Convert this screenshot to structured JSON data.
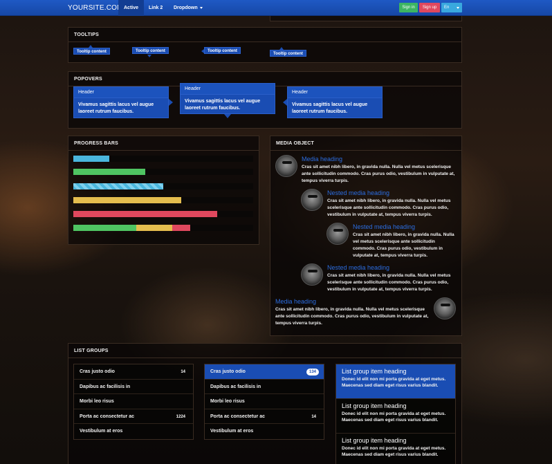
{
  "navbar": {
    "brand": "YOURSITE.COM",
    "items": [
      {
        "label": "Active"
      },
      {
        "label": "Link 2"
      },
      {
        "label": "Dropdown"
      }
    ],
    "buttons": {
      "signin": "Sign in",
      "signup": "Sign up",
      "lang": "En"
    }
  },
  "tooltips": {
    "title": "TOOLTIPS",
    "items": [
      "Tooltip content",
      "Tooltip content",
      "Tooltip content",
      "Tooltip content"
    ]
  },
  "popovers": {
    "title": "POPOVERS",
    "items": [
      {
        "header": "Header",
        "body": "Vivamus sagittis lacus vel augue laoreet rutrum faucibus."
      },
      {
        "header": "Header",
        "body": "Vivamus sagittis lacus vel augue laoreet rutrum faucibus."
      },
      {
        "header": "Header",
        "body": "Vivamus sagittis lacus vel augue laoreet rutrum faucibus."
      }
    ]
  },
  "progress": {
    "title": "PROGRESS BARS",
    "bars": [
      {
        "value": 20,
        "color": "#4ab6dd"
      },
      {
        "value": 40,
        "color": "#4fc462"
      },
      {
        "value": 50,
        "color": "#4ab6dd",
        "striped": true
      },
      {
        "value": 60,
        "color": "#e5bd4e"
      },
      {
        "value": 80,
        "color": "#e0485e"
      }
    ],
    "stacked": [
      {
        "value": 35,
        "color": "#4fc462"
      },
      {
        "value": 20,
        "color": "#e5bd4e"
      },
      {
        "value": 10,
        "color": "#e0485e"
      }
    ]
  },
  "media": {
    "title": "MEDIA OBJECT",
    "items": [
      {
        "heading": "Media heading",
        "text": "Cras sit amet nibh libero, in gravida nulla. Nulla vel metus scelerisque ante sollicitudin commodo. Cras purus odio, vestibulum in vulputate at, tempus viverra turpis."
      },
      {
        "heading": "Nested media heading",
        "text": "Cras sit amet nibh libero, in gravida nulla. Nulla vel metus scelerisque ante sollicitudin commodo. Cras purus odio, vestibulum in vulputate at, tempus viverra turpis."
      },
      {
        "heading": "Nested media heading",
        "text": "Cras sit amet nibh libero, in gravida nulla. Nulla vel metus scelerisque ante sollicitudin commodo. Cras purus odio, vestibulum in vulputate at, tempus viverra turpis."
      },
      {
        "heading": "Nested media heading",
        "text": "Cras sit amet nibh libero, in gravida nulla. Nulla vel metus scelerisque ante sollicitudin commodo. Cras purus odio, vestibulum in vulputate at, tempus viverra turpis."
      },
      {
        "heading": "Media heading",
        "text": "Cras sit amet nibh libero, in gravida nulla. Nulla vel metus scelerisque ante sollicitudin commodo. Cras purus odio, vestibulum in vulputate at, tempus viverra turpis."
      }
    ]
  },
  "list_groups": {
    "title": "LIST GROUPS",
    "group1": [
      {
        "label": "Cras justo odio",
        "badge": "14"
      },
      {
        "label": "Dapibus ac facilisis in",
        "badge": ""
      },
      {
        "label": "Morbi leo risus",
        "badge": ""
      },
      {
        "label": "Porta ac consectetur ac",
        "badge": "1224"
      },
      {
        "label": "Vestibulum at eros",
        "badge": ""
      }
    ],
    "group2": [
      {
        "label": "Cras justo odio",
        "badge": "134"
      },
      {
        "label": "Dapibus ac facilisis in",
        "badge": ""
      },
      {
        "label": "Morbi leo risus",
        "badge": ""
      },
      {
        "label": "Porta ac consectetur ac",
        "badge": "14"
      },
      {
        "label": "Vestibulum at eros",
        "badge": ""
      }
    ],
    "group3": [
      {
        "heading": "List group item heading",
        "text": "Donec id elit non mi porta gravida at eget metus. Maecenas sed diam eget risus varius blandit."
      },
      {
        "heading": "List group item heading",
        "text": "Donec id elit non mi porta gravida at eget metus. Maecenas sed diam eget risus varius blandit."
      },
      {
        "heading": "List group item heading",
        "text": "Donec id elit non mi porta gravida at eget metus. Maecenas sed diam eget risus varius blandit."
      }
    ]
  }
}
